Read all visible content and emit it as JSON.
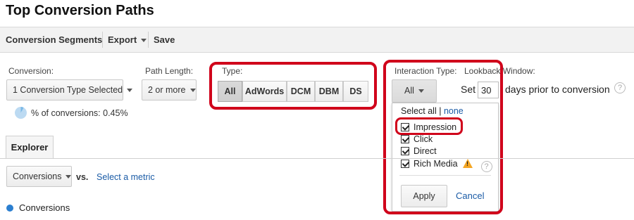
{
  "page": {
    "title": "Top Conversion Paths"
  },
  "toolbar": {
    "conversion_segments": "Conversion Segments",
    "export": "Export",
    "save": "Save"
  },
  "filters": {
    "conversion": {
      "label": "Conversion:",
      "value": "1 Conversion Type Selected"
    },
    "path_length": {
      "label": "Path Length:",
      "value": "2 or more"
    },
    "type": {
      "label": "Type:",
      "options": [
        "All",
        "AdWords",
        "DCM",
        "DBM",
        "DS"
      ],
      "selected": "All"
    },
    "interaction_type": {
      "label": "Interaction Type:",
      "value": "All"
    },
    "lookback": {
      "label": "Lookback Window:",
      "set_label": "Set",
      "days": "30",
      "suffix": "days prior to conversion"
    },
    "help": "?"
  },
  "percent_conversions": "% of conversions: 0.45%",
  "interaction_popup": {
    "select_all": "Select all",
    "separator": "|",
    "none": "none",
    "options": [
      {
        "label": "Impression",
        "checked": true
      },
      {
        "label": "Click",
        "checked": true
      },
      {
        "label": "Direct",
        "checked": true
      },
      {
        "label": "Rich Media",
        "checked": true
      }
    ],
    "warning_glyph": "!",
    "help": "?",
    "apply": "Apply",
    "cancel": "Cancel"
  },
  "explorer": {
    "tab": "Explorer",
    "metric": "Conversions",
    "vs": "vs.",
    "select_metric": "Select a metric",
    "legend": "Conversions"
  },
  "colors": {
    "highlight_red": "#d0021b",
    "link_blue": "#1a5ba6",
    "legend_dot": "#2b7fd0"
  }
}
